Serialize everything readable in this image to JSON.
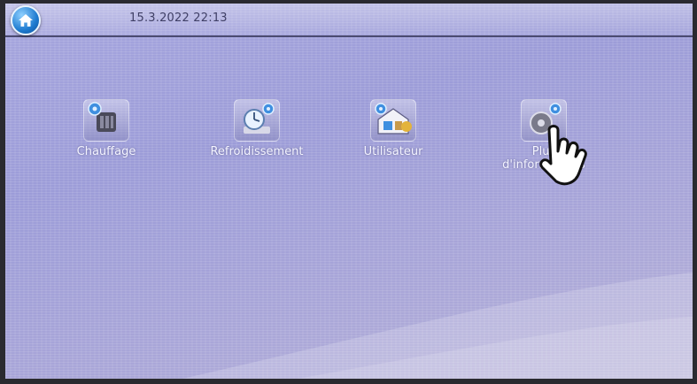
{
  "header": {
    "datetime": "15.3.2022 22:13",
    "home_icon": "home-icon"
  },
  "tiles": [
    {
      "label": "Chauffage",
      "icon": "heating-icon"
    },
    {
      "label": "Refroidissement",
      "icon": "cooling-icon"
    },
    {
      "label": "Utilisateur",
      "icon": "user-house-icon"
    },
    {
      "label": "Plus d'informations",
      "icon": "info-gear-icon"
    }
  ],
  "pointer": {
    "icon": "hand-pointer-icon"
  },
  "colors": {
    "background": "#a6a6de",
    "label": "#f4f4ff",
    "home_button": "#1e7bd0"
  }
}
